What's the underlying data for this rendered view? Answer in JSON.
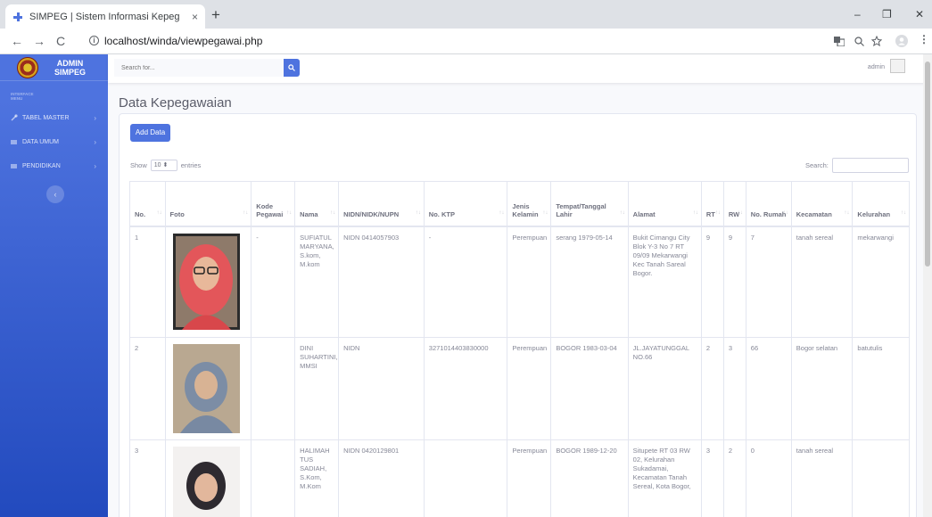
{
  "browser": {
    "tab_title": "SIMPEG | Sistem Informasi Kepeg",
    "tab_close": "×",
    "new_tab": "+",
    "url": "localhost/winda/viewpegawai.php",
    "back": "←",
    "forward": "→",
    "reload": "C",
    "minimize": "–",
    "restore": "❐",
    "close": "✕"
  },
  "sidebar": {
    "brand_line1": "ADMIN",
    "brand_line2": "SIMPEG",
    "heading_line1": "INTERFACE",
    "heading_line2": "MENU",
    "items": [
      {
        "label": "TABEL MASTER",
        "icon": "wrench-icon"
      },
      {
        "label": "DATA UMUM",
        "icon": "folder-icon"
      },
      {
        "label": "PENDIDIKAN",
        "icon": "folder-icon"
      }
    ],
    "toggle": "‹"
  },
  "topbar": {
    "search_placeholder": "Search for...",
    "search_icon": "🔍",
    "user_name": "admin"
  },
  "page": {
    "title": "Data Kepegawaian",
    "add_button": "Add Data",
    "show_label": "Show",
    "entries_value": "10",
    "entries_label": "entries",
    "search_label": "Search:"
  },
  "table": {
    "headers": [
      "No.",
      "Foto",
      "Kode Pegawai",
      "Nama",
      "NIDN/NIDK/NUPN",
      "No. KTP",
      "Jenis Kelamin",
      "Tempat/Tanggal Lahir",
      "Alamat",
      "RT",
      "RW",
      "No. Rumah",
      "Kecamatan",
      "Kelurahan"
    ],
    "rows": [
      {
        "no": "1",
        "kode": "-",
        "nama": "SUFIATUL MARYANA, S.kom, M.kom",
        "nidn": "NIDN 0414057903",
        "ktp": "-",
        "jk": "Perempuan",
        "ttl": "serang 1979-05-14",
        "alamat": "Bukit Cimangu City Blok Y-3 No 7 RT 09/09 Mekarwangi Kec Tanah Sareal Bogor.",
        "rt": "9",
        "rw": "9",
        "rumah": "7",
        "kecamatan": "tanah sereal",
        "kelurahan": "mekarwangi"
      },
      {
        "no": "2",
        "kode": "",
        "nama": "DINI SUHARTINI, MMSI",
        "nidn": "NIDN",
        "ktp": "3271014403830000",
        "jk": "Perempuan",
        "ttl": "BOGOR 1983-03-04",
        "alamat": "JL.JAYATUNGGAL NO.66",
        "rt": "2",
        "rw": "3",
        "rumah": "66",
        "kecamatan": "Bogor selatan",
        "kelurahan": "batutulis"
      },
      {
        "no": "3",
        "kode": "",
        "nama": "HALIMAH TUS SADIAH, S.Kom, M.Kom",
        "nidn": "NIDN 0420129801",
        "ktp": "",
        "jk": "Perempuan",
        "ttl": "BOGOR 1989-12-20",
        "alamat": "Situpete RT 03 RW 02, Kelurahan Sukadamai, Kecamatan Tanah Sereal, Kota Bogor,",
        "rt": "3",
        "rw": "2",
        "rumah": "0",
        "kecamatan": "tanah sereal",
        "kelurahan": ""
      }
    ]
  },
  "colors": {
    "primary": "#4e73df",
    "sidebar_dark": "#224abe",
    "text": "#858796",
    "heading": "#5a5c69"
  }
}
